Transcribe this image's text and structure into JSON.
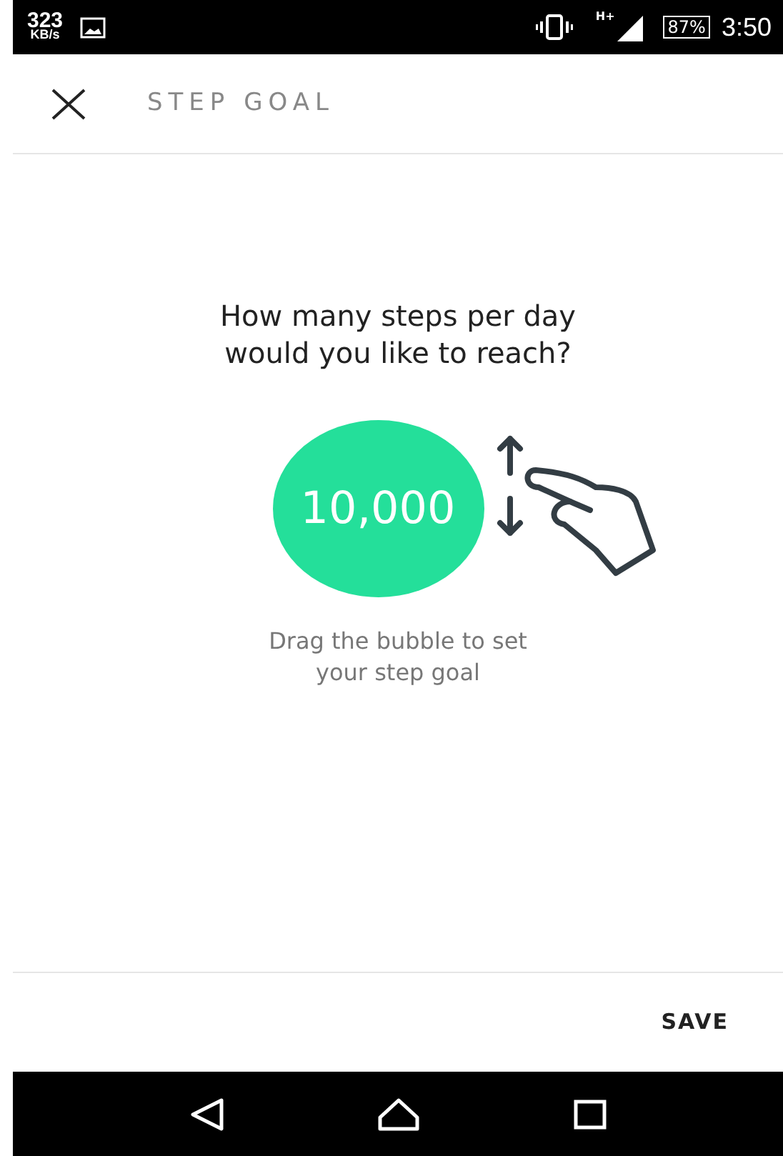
{
  "status_bar": {
    "speed": "323",
    "speed_unit": "KB/s",
    "network": "H+",
    "battery": "87%",
    "time": "3:50"
  },
  "header": {
    "title": "STEP GOAL"
  },
  "prompt": "How many steps per day would you like to reach?",
  "bubble": {
    "value": "10,000",
    "color": "#24df9a"
  },
  "hint": "Drag the bubble to set your step goal",
  "footer": {
    "save": "SAVE"
  }
}
